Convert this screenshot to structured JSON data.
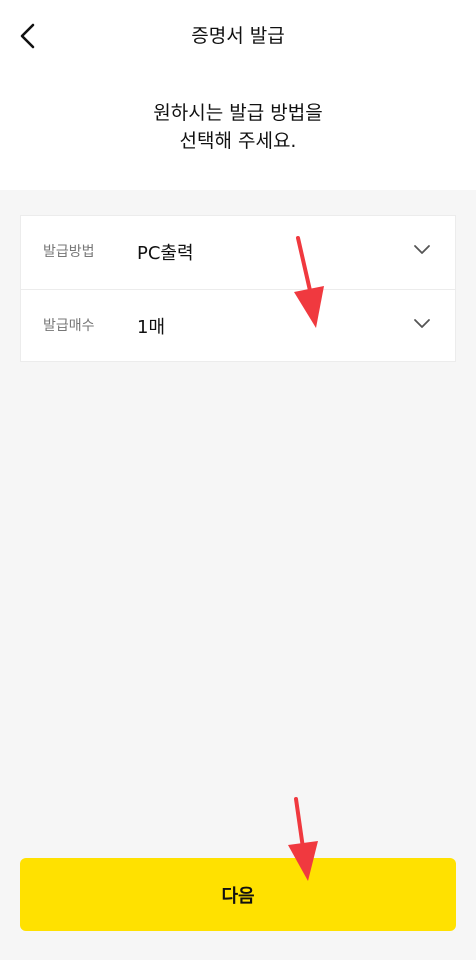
{
  "header": {
    "title": "증명서 발급",
    "back_icon": "chevron-left-icon"
  },
  "instruction": {
    "line1": "원하시는 발급 방법을",
    "line2": "선택해 주세요."
  },
  "form": {
    "rows": [
      {
        "label": "발급방법",
        "value": "PC출력",
        "icon": "chevron-down-icon"
      },
      {
        "label": "발급매수",
        "value": "1매",
        "icon": "chevron-down-icon"
      }
    ]
  },
  "footer": {
    "next_label": "다음"
  },
  "colors": {
    "accent": "#ffe100",
    "annotation": "#f0393f",
    "background": "#f6f6f6",
    "surface": "#ffffff"
  }
}
